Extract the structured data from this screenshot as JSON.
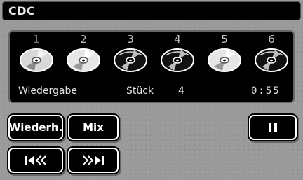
{
  "header": {
    "title": "CDC"
  },
  "discs": [
    {
      "number": "1",
      "loaded": false
    },
    {
      "number": "2",
      "loaded": true
    },
    {
      "number": "3",
      "loaded": true
    },
    {
      "number": "4",
      "loaded": true
    },
    {
      "number": "5",
      "loaded": true
    },
    {
      "number": "6",
      "loaded": true
    }
  ],
  "status": {
    "mode_label": "Wiedergabe",
    "track_label": "Stück",
    "track_number": "4",
    "elapsed_time": "0:55"
  },
  "buttons": {
    "repeat_label": "Wiederh.",
    "mix_label": "Mix",
    "pause_icon": "pause-icon",
    "prev_icon": "skip-back-icon",
    "next_icon": "skip-forward-icon"
  }
}
